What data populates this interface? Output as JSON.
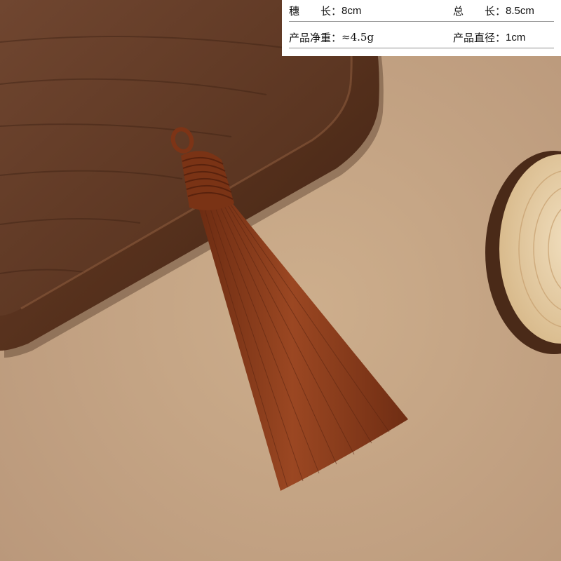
{
  "specs": {
    "row1": {
      "tassel_label": "穗　　长：",
      "tassel_value": "8cm",
      "total_label": "总　　长：",
      "total_value": "8.5cm"
    },
    "row2": {
      "weight_label": "产品净重：",
      "weight_value": "≈4.5g",
      "diameter_label": "产品直径：",
      "diameter_value": "1cm"
    }
  },
  "colors": {
    "background_paper": "#c8a886",
    "wood_tray": "#5a3421",
    "tassel": "#8c3e1e",
    "wood_slice": "#e6cfa8"
  }
}
